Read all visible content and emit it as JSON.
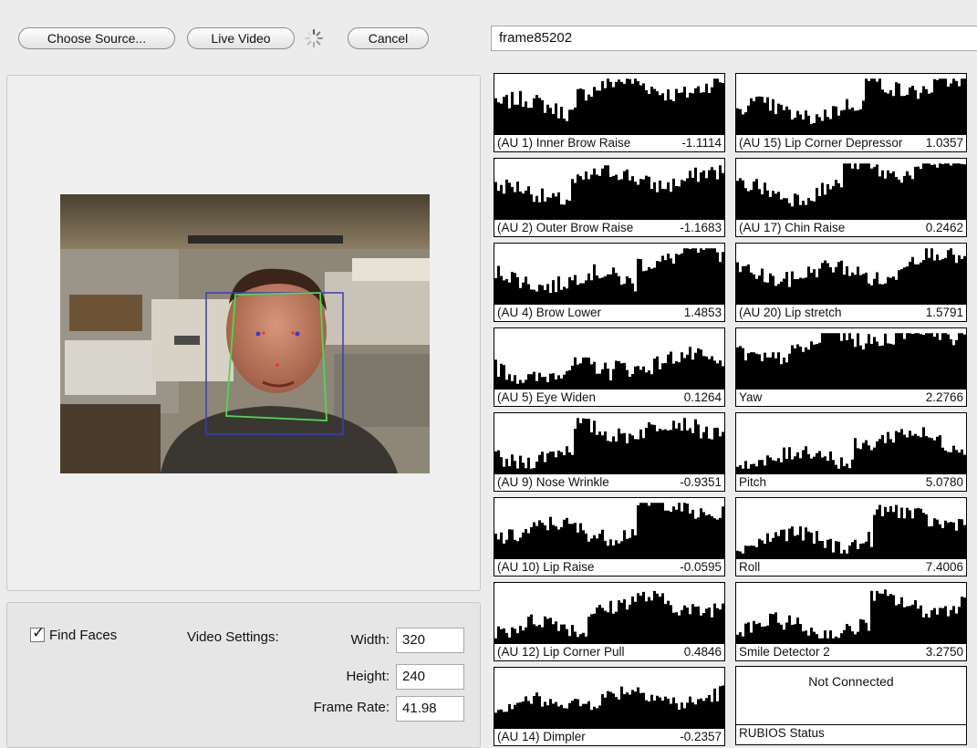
{
  "toolbar": {
    "choose_source_label": "Choose Source...",
    "live_video_label": "Live Video",
    "cancel_label": "Cancel",
    "frame_name": "frame85202"
  },
  "settings": {
    "find_faces_label": "Find Faces",
    "find_faces_checked": true,
    "video_settings_label": "Video Settings:",
    "width_label": "Width:",
    "width_value": "320",
    "height_label": "Height:",
    "height_value": "240",
    "frame_rate_label": "Frame Rate:",
    "frame_rate_value": "41.98"
  },
  "au_left": [
    {
      "name": "(AU 1) Inner Brow Raise",
      "value": "-1.1114"
    },
    {
      "name": "(AU 2) Outer Brow Raise",
      "value": "-1.1683"
    },
    {
      "name": "(AU 4) Brow Lower",
      "value": "1.4853"
    },
    {
      "name": "(AU 5) Eye Widen",
      "value": "0.1264"
    },
    {
      "name": "(AU 9) Nose Wrinkle",
      "value": "-0.9351"
    },
    {
      "name": "(AU 10) Lip Raise",
      "value": "-0.0595"
    },
    {
      "name": "(AU 12) Lip Corner Pull",
      "value": "0.4846"
    },
    {
      "name": "(AU 14) Dimpler",
      "value": "-0.2357"
    }
  ],
  "au_right": [
    {
      "name": "(AU 15) Lip Corner Depressor",
      "value": "1.0357"
    },
    {
      "name": "(AU 17) Chin Raise",
      "value": "0.2462"
    },
    {
      "name": "(AU 20) Lip stretch",
      "value": "1.5791"
    },
    {
      "name": "Yaw",
      "value": "2.2766"
    },
    {
      "name": "Pitch",
      "value": "5.0780"
    },
    {
      "name": "Roll",
      "value": "7.4006"
    },
    {
      "name": "Smile Detector 2",
      "value": "3.2750"
    }
  ],
  "status": {
    "message": "Not Connected",
    "label": "RUBIOS Status"
  },
  "colors": {
    "window_bg": "#ececec",
    "face_box": "#3a3acc",
    "face_outline": "#4fd84f",
    "landmark": "#e23b3b"
  }
}
